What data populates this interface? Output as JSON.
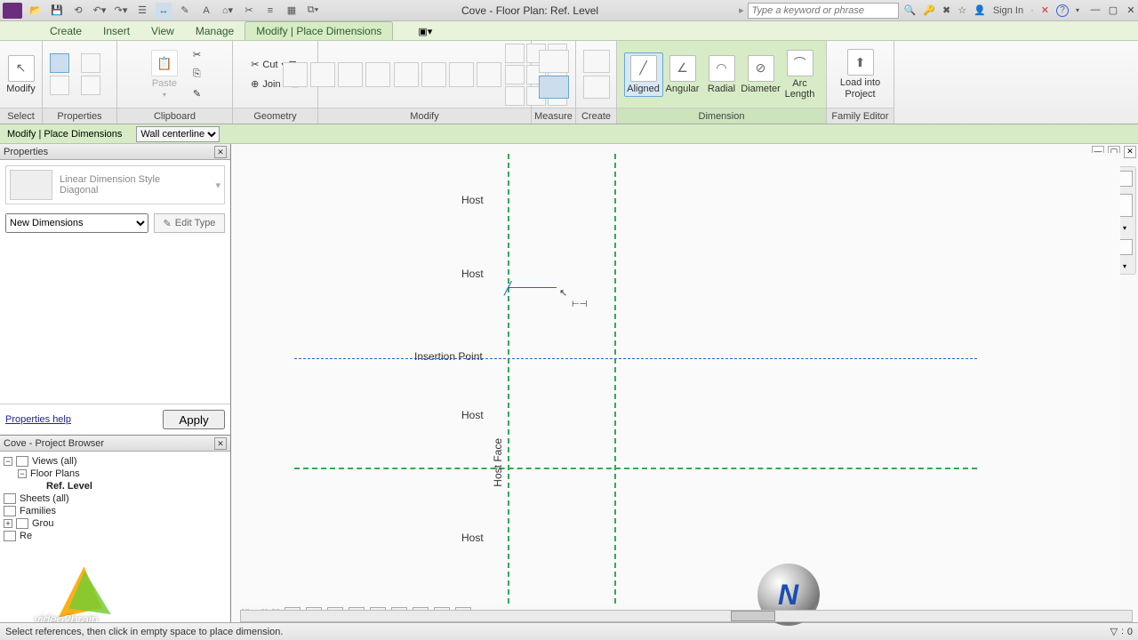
{
  "titlebar": {
    "title": "Cove - Floor Plan: Ref. Level",
    "search_placeholder": "Type a keyword or phrase",
    "signin": "Sign In"
  },
  "tabs": {
    "create": "Create",
    "insert": "Insert",
    "view": "View",
    "manage": "Manage",
    "modify": "Modify | Place Dimensions"
  },
  "ribbon": {
    "select": {
      "modify": "Modify",
      "title": "Select"
    },
    "properties": {
      "title": "Properties"
    },
    "clipboard": {
      "paste": "Paste",
      "cut": "Cut",
      "join": "Join",
      "title": "Clipboard"
    },
    "geometry": {
      "title": "Geometry"
    },
    "modify_panel": {
      "title": "Modify"
    },
    "measure": {
      "title": "Measure"
    },
    "create_panel": {
      "title": "Create"
    },
    "dimension": {
      "aligned": "Aligned",
      "angular": "Angular",
      "radial": "Radial",
      "diameter": "Diameter",
      "arc": "Arc Length",
      "title": "Dimension"
    },
    "family": {
      "load": "Load into Project",
      "title": "Family Editor"
    }
  },
  "optbar": {
    "context": "Modify | Place Dimensions",
    "pick": "Wall centerline"
  },
  "properties": {
    "title": "Properties",
    "type_name": "Linear Dimension Style",
    "type_sub": "Diagonal",
    "instance": "New Dimensions",
    "edit_type": "Edit Type",
    "help": "Properties help",
    "apply": "Apply"
  },
  "browser": {
    "title": "Cove - Project Browser",
    "views": "Views (all)",
    "floorplans": "Floor Plans",
    "reflevel": "Ref. Level",
    "sheets": "Sheets (all)",
    "families": "Families",
    "groups": "Grou",
    "revit": "Re"
  },
  "canvas": {
    "host": "Host",
    "insertion": "Insertion Point",
    "hostface": "Host Face",
    "scale": "1\" = 1'-0\""
  },
  "status": {
    "hint": "Select references, then click in empty space to place dimension.",
    "filter": "0"
  },
  "watermark": "video2brain"
}
